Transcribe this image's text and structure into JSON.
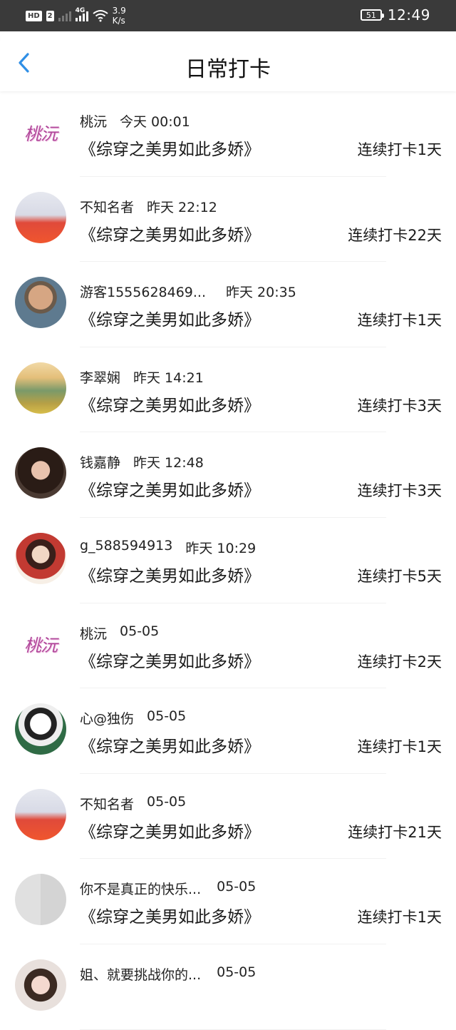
{
  "status_bar": {
    "hd": "HD",
    "sim": "2",
    "network": "4G",
    "speed_value": "3.9",
    "speed_unit": "K/s",
    "battery": "51",
    "time": "12:49"
  },
  "header": {
    "title": "日常打卡",
    "back_icon": "chevron-left-icon",
    "accent": "#2f8fe6"
  },
  "checkins": [
    {
      "user": "桃沅",
      "time": "今天 00:01",
      "book": "《综穿之美男如此多娇》",
      "streak": "连续打卡1天",
      "avatar": "logo"
    },
    {
      "user": "不知名者",
      "time": "昨天 22:12",
      "book": "《综穿之美男如此多娇》",
      "streak": "连续打卡22天",
      "avatar": "anime"
    },
    {
      "user": "游客1555628469...",
      "time": "昨天 20:35",
      "book": "《综穿之美男如此多娇》",
      "streak": "连续打卡1天",
      "avatar": "boy"
    },
    {
      "user": "李翠娴",
      "time": "昨天 14:21",
      "book": "《综穿之美男如此多娇》",
      "streak": "连续打卡3天",
      "avatar": "landscape"
    },
    {
      "user": "钱嘉静",
      "time": "昨天 12:48",
      "book": "《综穿之美男如此多娇》",
      "streak": "连续打卡3天",
      "avatar": "girl"
    },
    {
      "user": "g_588594913",
      "time": "昨天 10:29",
      "book": "《综穿之美男如此多娇》",
      "streak": "连续打卡5天",
      "avatar": "hanfu"
    },
    {
      "user": "桃沅",
      "time": "05-05",
      "book": "《综穿之美男如此多娇》",
      "streak": "连续打卡2天",
      "avatar": "logo"
    },
    {
      "user": "心@独伤",
      "time": "05-05",
      "book": "《综穿之美男如此多娇》",
      "streak": "连续打卡1天",
      "avatar": "sketch"
    },
    {
      "user": "不知名者",
      "time": "05-05",
      "book": "《综穿之美男如此多娇》",
      "streak": "连续打卡21天",
      "avatar": "anime"
    },
    {
      "user": "你不是真正的快乐...",
      "time": "05-05",
      "book": "《综穿之美男如此多娇》",
      "streak": "连续打卡1天",
      "avatar": "kids"
    },
    {
      "user": "姐、就要挑战你的...",
      "time": "05-05",
      "book": "",
      "streak": "",
      "avatar": "girl2"
    }
  ],
  "logo_text": "桃沅"
}
